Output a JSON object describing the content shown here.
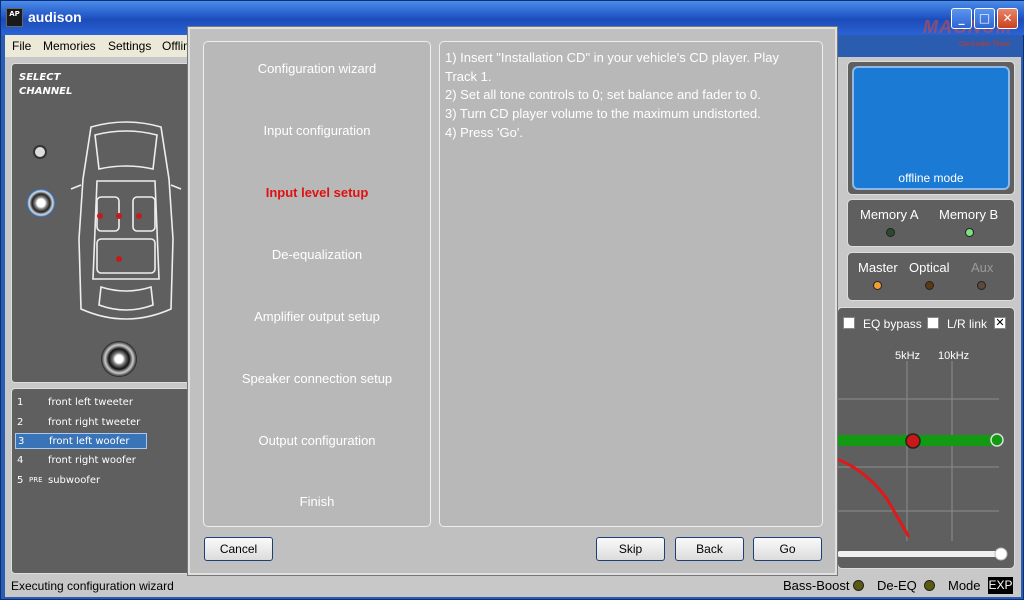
{
  "window": {
    "title": "audison",
    "logo": "MAGNUM",
    "logo_sub": "CarAudio Team",
    "app_icon": "AP"
  },
  "menu": {
    "items": [
      "File",
      "Memories",
      "Settings",
      "Offlin"
    ]
  },
  "left_panel": {
    "select_channel": "SELECT CHANNEL",
    "channels": [
      {
        "num": "1",
        "prefix": "",
        "label": "front left tweeter",
        "selected": false
      },
      {
        "num": "2",
        "prefix": "",
        "label": "front right tweeter",
        "selected": false
      },
      {
        "num": "3",
        "prefix": "",
        "label": "front left woofer",
        "selected": true
      },
      {
        "num": "4",
        "prefix": "",
        "label": "front right woofer",
        "selected": false
      },
      {
        "num": "5",
        "prefix": "PRE",
        "label": "subwoofer",
        "selected": false
      }
    ]
  },
  "right_panel": {
    "screen_label": "offline mode",
    "memory_a": "Memory A",
    "memory_b": "Memory B",
    "master": "Master",
    "optical": "Optical",
    "aux": "Aux",
    "eq_bypass": "EQ bypass",
    "lr_link": "L/R link",
    "freq_5k": "5kHz",
    "freq_10k": "10kHz",
    "colors": {
      "led_green": "#7ee07e",
      "led_dark": "#2c4a2c",
      "led_orange": "#f0a030",
      "eq_curve_green": "#129a12",
      "eq_curve_red": "#e01818",
      "screen": "#1a7ad4"
    }
  },
  "status_bar": {
    "text": "Executing configuration wizard",
    "bass_boost": "Bass-Boost",
    "de_eq": "De-EQ",
    "mode": "Mode",
    "exp": "EXP"
  },
  "dialog": {
    "steps": [
      {
        "label": "Configuration wizard",
        "active": false
      },
      {
        "label": "Input configuration",
        "active": false
      },
      {
        "label": "Input level setup",
        "active": true
      },
      {
        "label": "De-equalization",
        "active": false
      },
      {
        "label": "Amplifier output setup",
        "active": false
      },
      {
        "label": "Speaker connection setup",
        "active": false
      },
      {
        "label": "Output configuration",
        "active": false
      },
      {
        "label": "Finish",
        "active": false
      }
    ],
    "instructions": [
      "1) Insert \"Installation CD\" in your vehicle's CD player. Play",
      "Track 1.",
      "2) Set all tone controls to 0; set balance and fader to 0.",
      "3) Turn CD player volume to the maximum undistorted.",
      "4) Press 'Go'."
    ],
    "buttons": {
      "cancel": "Cancel",
      "skip": "Skip",
      "back": "Back",
      "go": "Go"
    }
  }
}
